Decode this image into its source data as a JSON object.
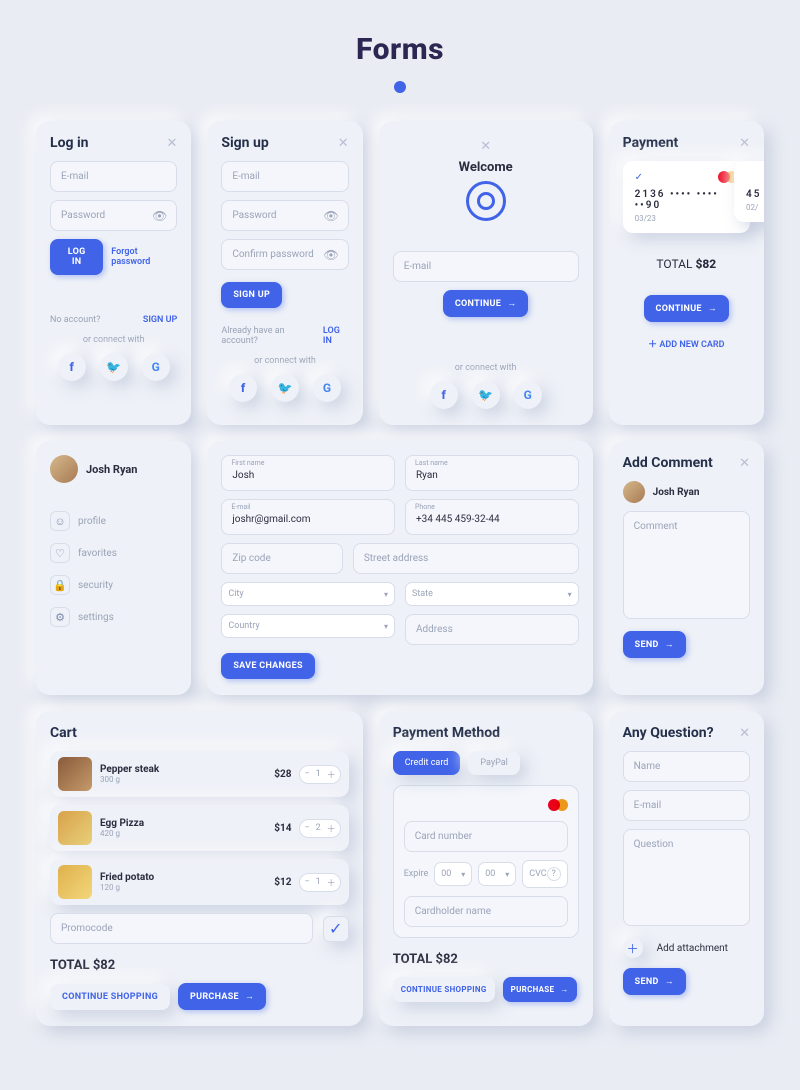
{
  "page": {
    "title": "Forms"
  },
  "common": {
    "connect": "or connect with",
    "close": "✕",
    "arrow": "→"
  },
  "login": {
    "title": "Log in",
    "email_ph": "E-mail",
    "password_ph": "Password",
    "submit": "LOG IN",
    "forgot": "Forgot password",
    "no_account": "No account?",
    "signup": "SIGN UP"
  },
  "signup": {
    "title": "Sign up",
    "email_ph": "E-mail",
    "password_ph": "Password",
    "confirm_ph": "Confirm password",
    "submit": "SIGN UP",
    "have_account": "Already have an account?",
    "login": "LOG IN"
  },
  "welcome": {
    "title": "Welcome",
    "email_ph": "E-mail",
    "continue": "CONTINUE"
  },
  "payment": {
    "title": "Payment",
    "card1_num": "2136 •••• •••• ••90",
    "card1_exp": "03/23",
    "card2_num": "45",
    "card2_exp": "02/",
    "total_label": "TOTAL",
    "total_value": "$82",
    "continue": "CONTINUE",
    "add_new": "ADD NEW CARD"
  },
  "profile": {
    "name": "Josh Ryan",
    "menu": [
      "profile",
      "favorites",
      "security",
      "settings"
    ],
    "form": {
      "first_label": "First name",
      "first": "Josh",
      "last_label": "Last name",
      "last": "Ryan",
      "email_label": "E-mail",
      "email": "joshr@gmail.com",
      "phone_label": "Phone",
      "phone": "+34 445 459-32-44",
      "zip_ph": "Zip code",
      "street_ph": "Street address",
      "city_ph": "City",
      "state_ph": "State",
      "country_ph": "Country",
      "address_ph": "Address",
      "save": "SAVE CHANGES"
    }
  },
  "comment": {
    "title": "Add Comment",
    "author": "Josh Ryan",
    "ph": "Comment",
    "send": "SEND"
  },
  "cart": {
    "title": "Cart",
    "items": [
      {
        "name": "Pepper steak",
        "wt": "300 g",
        "price": "$28",
        "qty": "1",
        "color": "linear-gradient(135deg,#8a5a3a,#c59a6a)"
      },
      {
        "name": "Egg Pizza",
        "wt": "420 g",
        "price": "$14",
        "qty": "2",
        "color": "linear-gradient(135deg,#d8a24a,#e8cf7a)"
      },
      {
        "name": "Fried potato",
        "wt": "120 g",
        "price": "$12",
        "qty": "1",
        "color": "linear-gradient(135deg,#e0b04d,#f2d77a)"
      }
    ],
    "promo_ph": "Promocode",
    "total_label": "TOTAL",
    "total_value": "$82",
    "continue": "CONTINUE SHOPPING",
    "purchase": "PURCHASE"
  },
  "pm": {
    "title": "Payment Method",
    "tab_cc": "Credit card",
    "tab_pp": "PayPal",
    "card_ph": "Card number",
    "expire": "Expire",
    "mm": "00",
    "yy": "00",
    "cvc": "CVC",
    "holder_ph": "Cardholder name",
    "total_label": "TOTAL",
    "total_value": "$82",
    "continue": "CONTINUE SHOPPING",
    "purchase": "PURCHASE"
  },
  "question": {
    "title": "Any Question?",
    "name_ph": "Name",
    "email_ph": "E-mail",
    "q_ph": "Question",
    "attach": "Add attachment",
    "send": "SEND"
  }
}
